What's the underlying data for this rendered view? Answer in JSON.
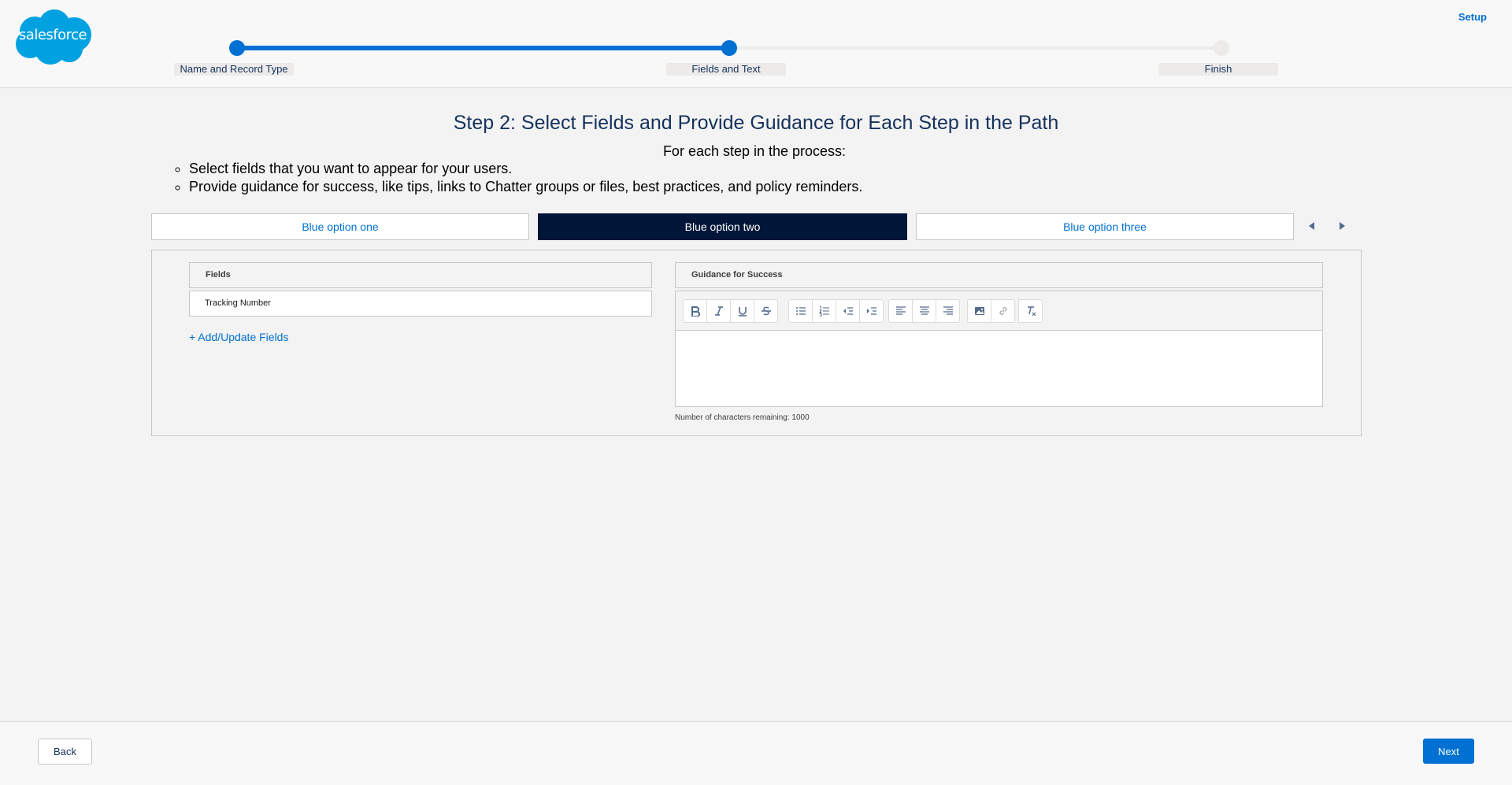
{
  "header": {
    "logo_text": "salesforce",
    "setup_label": "Setup",
    "steps": [
      {
        "label": "Name and Record Type",
        "state": "done"
      },
      {
        "label": "Fields and Text",
        "state": "current"
      },
      {
        "label": "Finish",
        "state": "todo"
      }
    ],
    "progress_fraction": 0.5
  },
  "main": {
    "title": "Step 2: Select Fields and Provide Guidance for Each Step in the Path",
    "subtitle": "For each step in the process:",
    "instructions": [
      "Select fields that you want to appear for your users.",
      "Provide guidance for success, like tips, links to Chatter groups or files, best practices, and policy reminders."
    ],
    "options": [
      {
        "label": "Blue option one",
        "active": false
      },
      {
        "label": "Blue option two",
        "active": true
      },
      {
        "label": "Blue option three",
        "active": false
      }
    ],
    "fields_header": "Fields",
    "fields": [
      "Tracking Number"
    ],
    "add_fields_label": "+ Add/Update Fields",
    "guidance_header": "Guidance for Success",
    "char_count": "Number of characters remaining: 1000",
    "toolbar_icons": [
      "bold-icon",
      "italic-icon",
      "underline-icon",
      "strikethrough-icon",
      "bullet-list-icon",
      "numbered-list-icon",
      "outdent-icon",
      "indent-icon",
      "align-left-icon",
      "align-center-icon",
      "align-right-icon",
      "image-icon",
      "link-icon",
      "clear-format-icon"
    ]
  },
  "footer": {
    "back_label": "Back",
    "next_label": "Next"
  },
  "colors": {
    "brand": "#0070d2",
    "title": "#16325c",
    "active_option": "#001639",
    "logo": "#00a1e0"
  }
}
